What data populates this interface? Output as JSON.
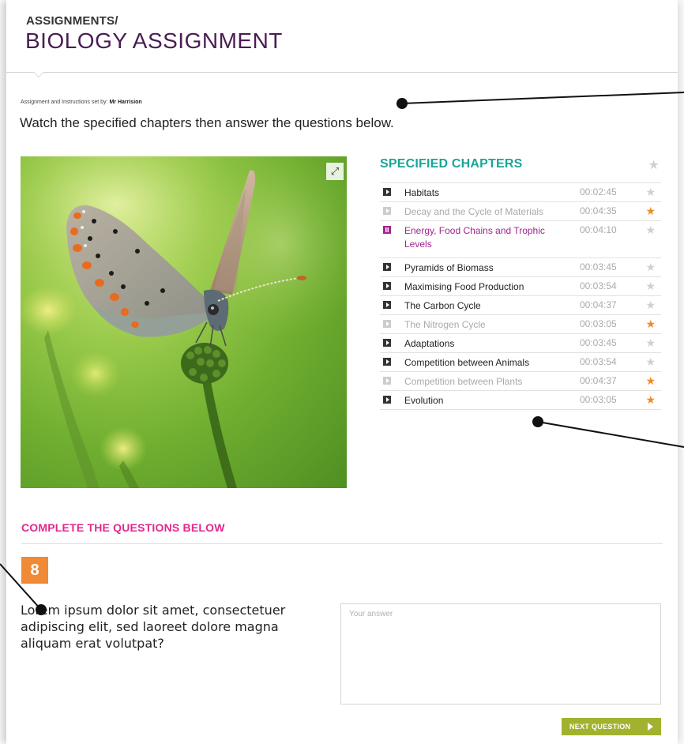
{
  "header": {
    "breadcrumb": "ASSIGNMENTS/",
    "title": "BIOLOGY ASSIGNMENT"
  },
  "assignment": {
    "set_by_label": "Assignment and Instructions set by:",
    "set_by_name": "Mr Harrision",
    "instructions": "Watch the specified chapters then answer the questions below."
  },
  "chapters": {
    "heading": "SPECIFIED CHAPTERS",
    "items": [
      {
        "title": "Habitats",
        "duration": "00:02:45",
        "state": "unwatched",
        "starred": false
      },
      {
        "title": "Decay and the Cycle of Materials",
        "duration": "00:04:35",
        "state": "watched",
        "starred": true
      },
      {
        "title": "Energy, Food Chains and Trophic Levels",
        "duration": "00:04:10",
        "state": "playing",
        "starred": false
      },
      {
        "title": "Pyramids of Biomass",
        "duration": "00:03:45",
        "state": "unwatched",
        "starred": false
      },
      {
        "title": "Maximising Food Production",
        "duration": "00:03:54",
        "state": "unwatched",
        "starred": false
      },
      {
        "title": "The Carbon Cycle",
        "duration": "00:04:37",
        "state": "unwatched",
        "starred": false
      },
      {
        "title": "The Nitrogen Cycle",
        "duration": "00:03:05",
        "state": "watched",
        "starred": true
      },
      {
        "title": "Adaptations",
        "duration": "00:03:45",
        "state": "unwatched",
        "starred": false
      },
      {
        "title": "Competition between Animals",
        "duration": "00:03:54",
        "state": "unwatched",
        "starred": false
      },
      {
        "title": "Competition between Plants",
        "duration": "00:04:37",
        "state": "watched",
        "starred": true
      },
      {
        "title": "Evolution",
        "duration": "00:03:05",
        "state": "unwatched",
        "starred": true
      }
    ]
  },
  "questions": {
    "heading": "COMPLETE THE QUESTIONS BELOW",
    "number": "8",
    "text": "Lorem ipsum dolor sit amet, consectetuer adipiscing elit, sed laoreet dolore magna aliquam erat volutpat?",
    "answer_placeholder": "Your answer",
    "next_label": "NEXT QUESTION"
  },
  "icons": {
    "star": "star-icon",
    "play": "play-icon",
    "pause": "pause-icon",
    "expand": "expand-icon",
    "next": "play-arrow-icon"
  },
  "colors": {
    "title": "#4a1d52",
    "chapters_heading": "#1aa598",
    "questions_heading": "#e0288f",
    "star_on": "#f08a24",
    "playing": "#a0258f",
    "question_number_bg": "#f08a36",
    "next_button": "#a3b22e"
  }
}
